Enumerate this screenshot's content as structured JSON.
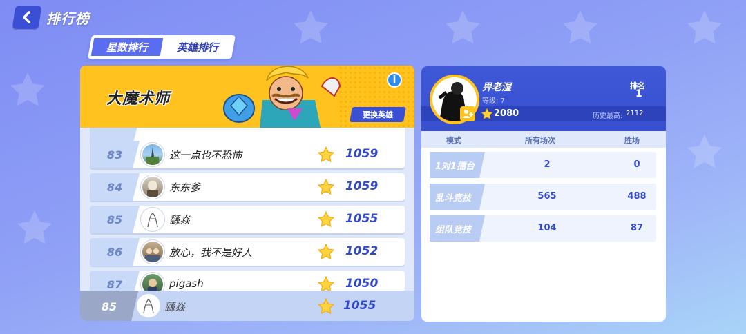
{
  "header": {
    "title": "排行榜"
  },
  "tabs": [
    {
      "label": "星数排行",
      "active": true
    },
    {
      "label": "英雄排行",
      "active": false
    }
  ],
  "hero": {
    "name": "大魔术师",
    "info_glyph": "i",
    "change_button": "更换英雄"
  },
  "leaderboard": [
    {
      "rank": "83",
      "name": "这一点也不恐怖",
      "score": "1059"
    },
    {
      "rank": "84",
      "name": "东东爹",
      "score": "1059"
    },
    {
      "rank": "85",
      "name": "繇焱",
      "score": "1055"
    },
    {
      "rank": "86",
      "name": "放心，我不是好人",
      "score": "1052"
    },
    {
      "rank": "87",
      "name": "pigash",
      "score": "1050"
    }
  ],
  "self_row": {
    "rank": "85",
    "name": "繇焱",
    "score": "1055"
  },
  "profile": {
    "name": "畀老湿",
    "level": "等级: 7",
    "stars": "2080",
    "history_label": "历史最高:",
    "history_value": "2112",
    "rank_label": "排名",
    "rank_value": "1"
  },
  "stats": {
    "headers": {
      "mode": "模式",
      "total": "所有场次",
      "wins": "胜场"
    },
    "rows": [
      {
        "mode": "1对1擂台",
        "total": "2",
        "wins": "0"
      },
      {
        "mode": "乱斗竞技",
        "total": "565",
        "wins": "488"
      },
      {
        "mode": "组队竞技",
        "total": "104",
        "wins": "87"
      }
    ]
  },
  "colors": {
    "accent": "#3a4fd4",
    "banner": "#ffc21f",
    "score": "#3148c8"
  },
  "icons": {
    "back": "chevron-left-icon",
    "star": "star-icon",
    "info": "info-icon",
    "add_friend": "add-friend-icon"
  }
}
